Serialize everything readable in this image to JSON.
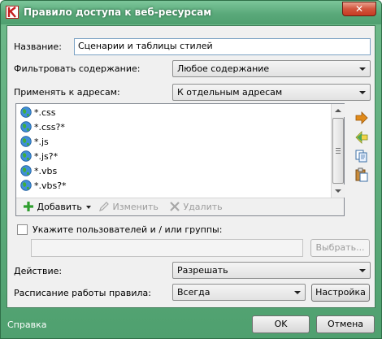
{
  "window": {
    "title": "Правило доступа к веб-ресурсам",
    "close_glyph": "✕"
  },
  "form": {
    "name_label": "Название:",
    "name_value": "Сценарии и таблицы стилей",
    "filter_label": "Фильтровать содержание:",
    "filter_value": "Любое содержание",
    "apply_label": "Применять к адресам:",
    "apply_value": "К отдельным адресам"
  },
  "addresses": {
    "items": [
      "*.css",
      "*.css?*",
      "*.js",
      "*.js?*",
      "*.vbs",
      "*.vbs?*"
    ],
    "add_label": "Добавить",
    "edit_label": "Изменить",
    "delete_label": "Удалить"
  },
  "users": {
    "checkbox_label": "Укажите пользователей и / или группы:",
    "field_value": "",
    "browse_label": "Выбрать..."
  },
  "action": {
    "label": "Действие:",
    "value": "Разрешать"
  },
  "schedule": {
    "label": "Расписание работы правила:",
    "value": "Всегда",
    "settings_label": "Настройка"
  },
  "footer": {
    "help_label": "Справка",
    "ok_label": "OK",
    "cancel_label": "Отмена"
  },
  "icons": [
    "app-icon",
    "globe-icon",
    "arrow-right-icon",
    "arrow-left-icon",
    "copy-icon",
    "paste-icon",
    "add-icon",
    "edit-icon",
    "delete-icon"
  ],
  "colors": {
    "frame": "#5aa97a",
    "client": "#f0f0f0"
  }
}
